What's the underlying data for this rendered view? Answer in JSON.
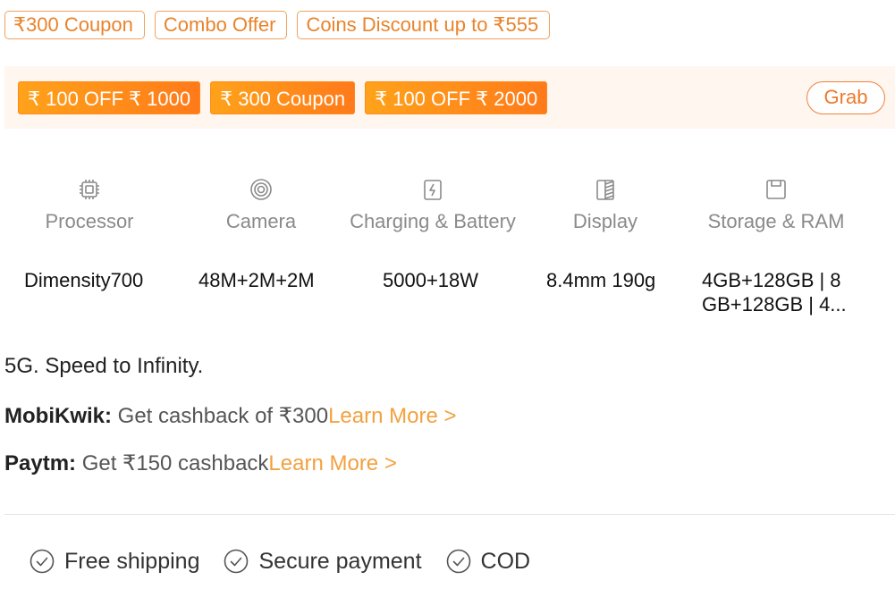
{
  "tags": [
    "₹300 Coupon",
    "Combo Offer",
    "Coins Discount up to ₹555"
  ],
  "coupons": [
    "₹ 100 OFF ₹ 1000",
    "₹ 300 Coupon",
    "₹ 100 OFF ₹ 2000"
  ],
  "grab_label": "Grab",
  "specs": [
    {
      "icon": "processor-icon",
      "label": "Processor",
      "value": "Dimensity700"
    },
    {
      "icon": "camera-icon",
      "label": "Camera",
      "value": "48M+2M+2M"
    },
    {
      "icon": "battery-icon",
      "label": "Charging & Battery",
      "value": "5000+18W"
    },
    {
      "icon": "display-icon",
      "label": "Display",
      "value": "8.4mm 190g"
    },
    {
      "icon": "storage-icon",
      "label": "Storage & RAM",
      "value": "4GB+128GB | 8 GB+128GB | 4..."
    }
  ],
  "tagline": "5G. Speed to Infinity.",
  "offers": [
    {
      "name": "MobiKwik:",
      "text": " Get cashback of ₹300",
      "link": "Learn More >"
    },
    {
      "name": "Paytm:",
      "text": " Get ₹150 cashback",
      "link": "Learn More >"
    }
  ],
  "services": [
    "Free shipping",
    "Secure payment",
    "COD"
  ],
  "colors": {
    "accent": "#f3a13e",
    "coupon_bg": "#ff8a1a",
    "strip_bg": "#fff6f0"
  }
}
